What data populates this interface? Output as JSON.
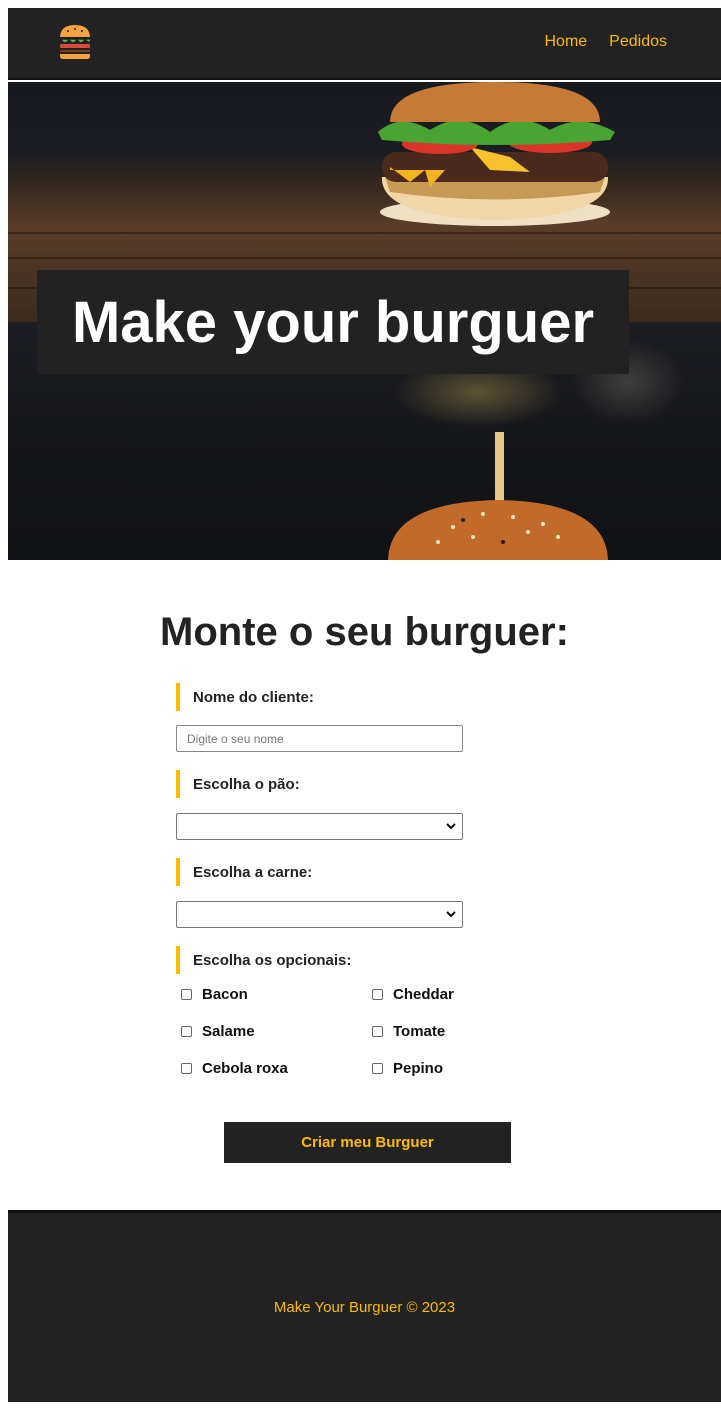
{
  "nav": {
    "logo_icon": "burger-icon",
    "links": [
      "Home",
      "Pedidos"
    ]
  },
  "hero": {
    "title": "Make your burguer"
  },
  "main": {
    "title": "Monte o seu burguer:"
  },
  "form": {
    "name_label": "Nome do cliente:",
    "name_placeholder": "Digite o seu nome",
    "name_value": "",
    "bread_label": "Escolha o pão:",
    "bread_selected": "",
    "meat_label": "Escolha a carne:",
    "meat_selected": "",
    "options_label": "Escolha os opcionais:",
    "options": [
      {
        "label": "Bacon",
        "checked": false
      },
      {
        "label": "Cheddar",
        "checked": false
      },
      {
        "label": "Salame",
        "checked": false
      },
      {
        "label": "Tomate",
        "checked": false
      },
      {
        "label": "Cebola roxa",
        "checked": false
      },
      {
        "label": "Pepino",
        "checked": false
      }
    ],
    "submit_label": "Criar meu Burguer"
  },
  "footer": {
    "text": "Make Your Burguer © 2023"
  },
  "colors": {
    "dark": "#222222",
    "accent": "#fcba03",
    "white": "#ffffff"
  }
}
